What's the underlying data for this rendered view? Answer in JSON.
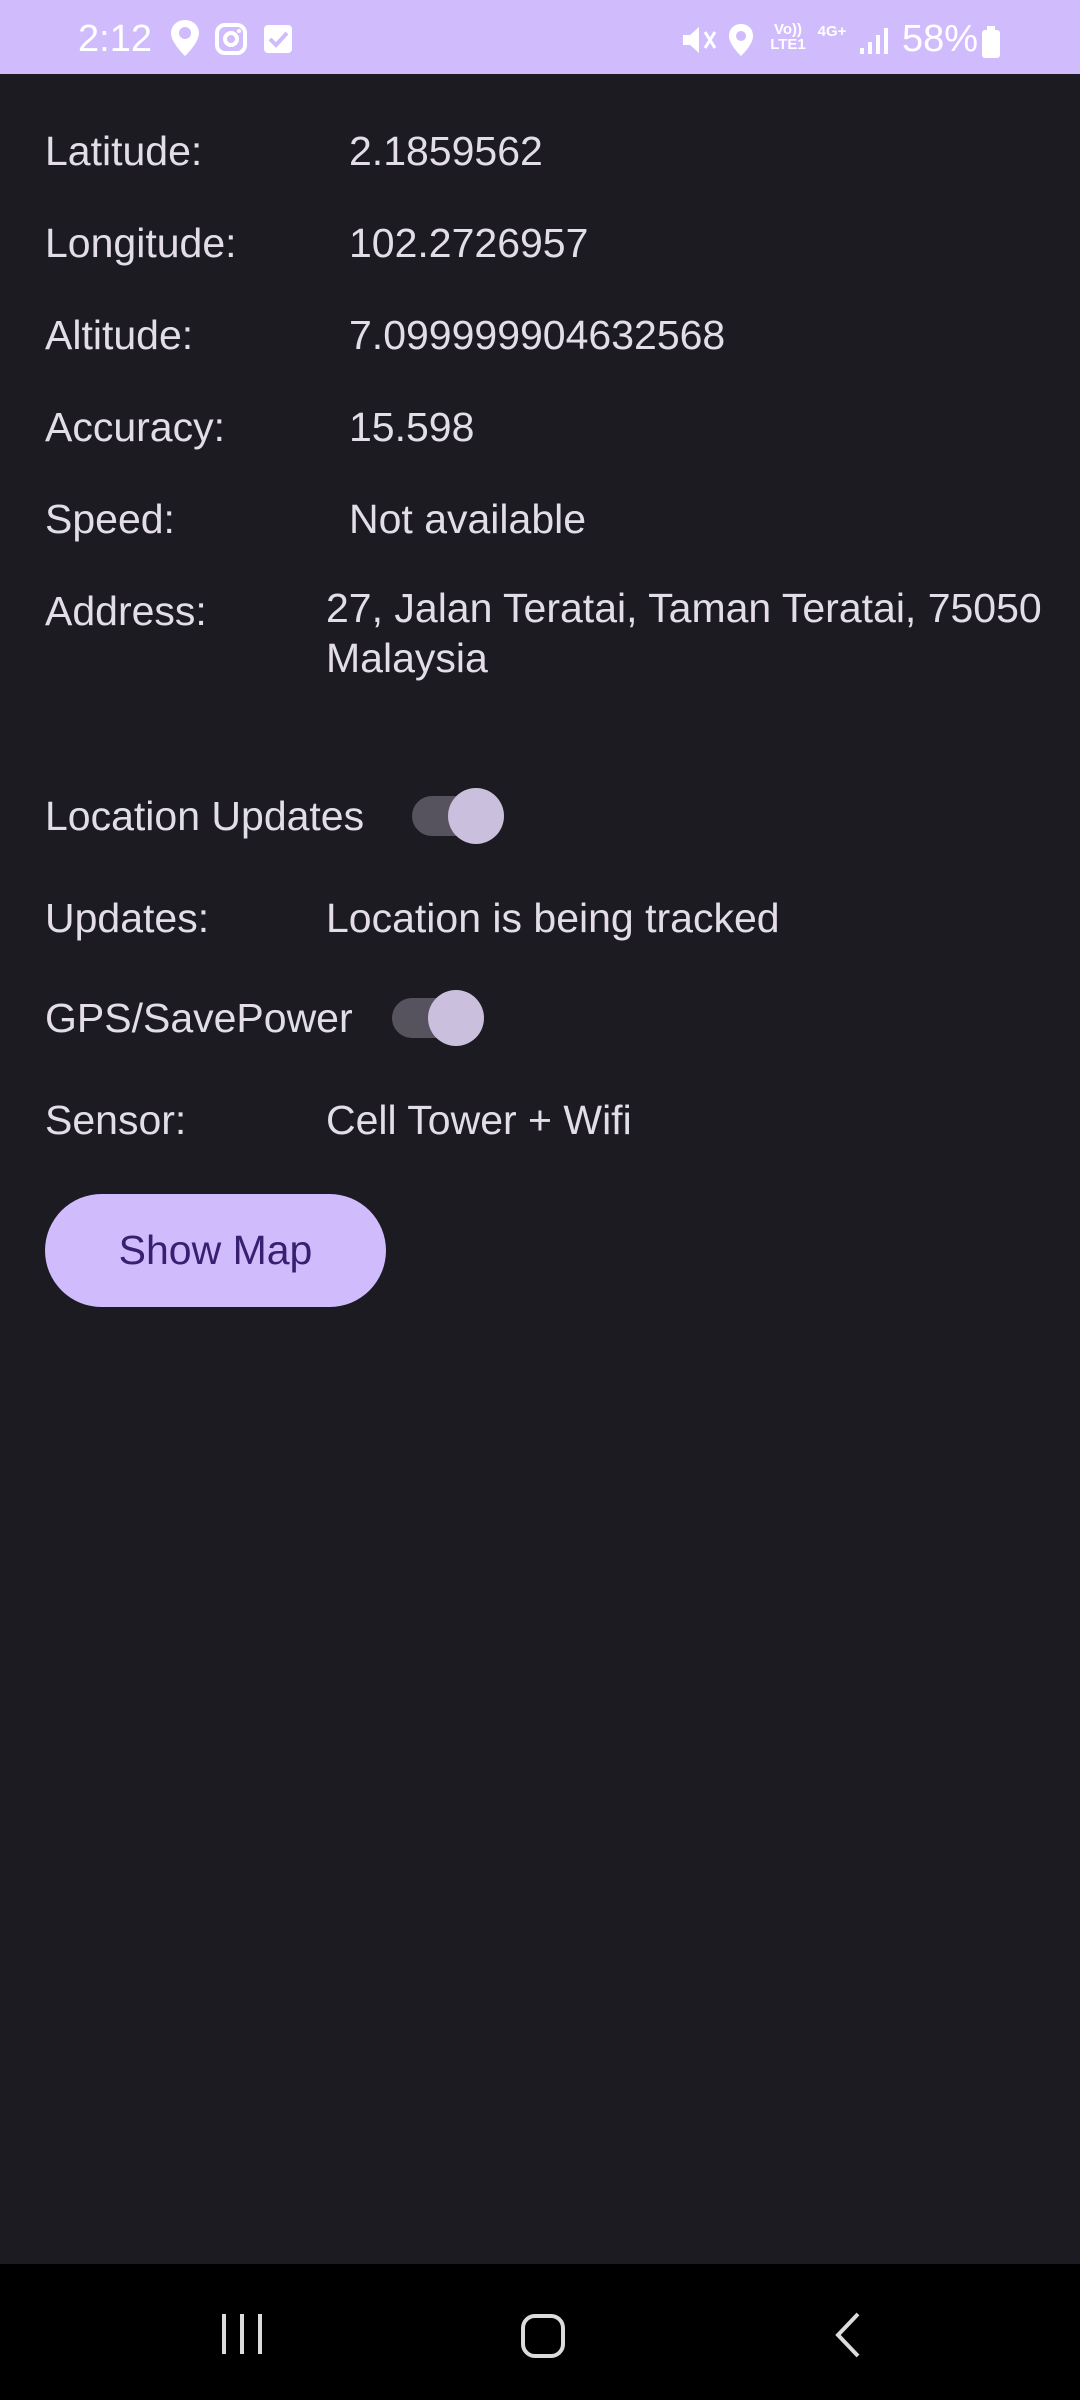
{
  "status_bar": {
    "time": "2:12",
    "battery": "58%",
    "volte": "Vo))\nLTE1",
    "network": "4G+",
    "icons": [
      "map-pin-icon",
      "instagram-icon",
      "checkbox-icon",
      "mute-icon",
      "location-icon",
      "signal-icon",
      "battery-icon"
    ]
  },
  "fields": {
    "latitude": {
      "label": "Latitude:",
      "value": "2.1859562"
    },
    "longitude": {
      "label": "Longitude:",
      "value": "102.2726957"
    },
    "altitude": {
      "label": "Altitude:",
      "value": "7.099999904632568"
    },
    "accuracy": {
      "label": "Accuracy:",
      "value": "15.598"
    },
    "speed": {
      "label": "Speed:",
      "value": "Not available"
    },
    "address": {
      "label": "Address:",
      "value": "27, Jalan Teratai, Taman Teratai, 75050 Malaysia"
    }
  },
  "location_updates": {
    "label": "Location Updates",
    "on": true
  },
  "updates": {
    "label": "Updates:",
    "value": "Location is being tracked"
  },
  "gps_savepower": {
    "label": "GPS/SavePower",
    "on": true
  },
  "sensor": {
    "label": "Sensor:",
    "value": "Cell Tower + Wifi"
  },
  "show_map_label": "Show Map",
  "colors": {
    "background": "#1d1b22",
    "accent": "#d0bcfd",
    "button_text": "#3a1f70",
    "text": "#e2dde6"
  },
  "nav": [
    "recents-icon",
    "home-icon",
    "back-icon"
  ]
}
